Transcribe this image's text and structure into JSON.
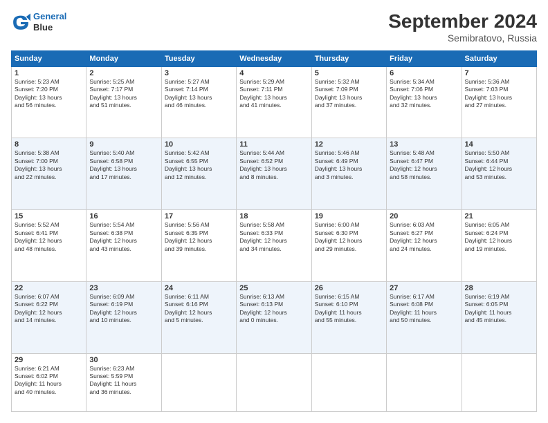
{
  "header": {
    "logo_line1": "General",
    "logo_line2": "Blue",
    "title": "September 2024",
    "subtitle": "Semibratovo, Russia"
  },
  "days_of_week": [
    "Sunday",
    "Monday",
    "Tuesday",
    "Wednesday",
    "Thursday",
    "Friday",
    "Saturday"
  ],
  "weeks": [
    [
      {
        "day": 1,
        "info": "Sunrise: 5:23 AM\nSunset: 7:20 PM\nDaylight: 13 hours\nand 56 minutes."
      },
      {
        "day": 2,
        "info": "Sunrise: 5:25 AM\nSunset: 7:17 PM\nDaylight: 13 hours\nand 51 minutes."
      },
      {
        "day": 3,
        "info": "Sunrise: 5:27 AM\nSunset: 7:14 PM\nDaylight: 13 hours\nand 46 minutes."
      },
      {
        "day": 4,
        "info": "Sunrise: 5:29 AM\nSunset: 7:11 PM\nDaylight: 13 hours\nand 41 minutes."
      },
      {
        "day": 5,
        "info": "Sunrise: 5:32 AM\nSunset: 7:09 PM\nDaylight: 13 hours\nand 37 minutes."
      },
      {
        "day": 6,
        "info": "Sunrise: 5:34 AM\nSunset: 7:06 PM\nDaylight: 13 hours\nand 32 minutes."
      },
      {
        "day": 7,
        "info": "Sunrise: 5:36 AM\nSunset: 7:03 PM\nDaylight: 13 hours\nand 27 minutes."
      }
    ],
    [
      {
        "day": 8,
        "info": "Sunrise: 5:38 AM\nSunset: 7:00 PM\nDaylight: 13 hours\nand 22 minutes."
      },
      {
        "day": 9,
        "info": "Sunrise: 5:40 AM\nSunset: 6:58 PM\nDaylight: 13 hours\nand 17 minutes."
      },
      {
        "day": 10,
        "info": "Sunrise: 5:42 AM\nSunset: 6:55 PM\nDaylight: 13 hours\nand 12 minutes."
      },
      {
        "day": 11,
        "info": "Sunrise: 5:44 AM\nSunset: 6:52 PM\nDaylight: 13 hours\nand 8 minutes."
      },
      {
        "day": 12,
        "info": "Sunrise: 5:46 AM\nSunset: 6:49 PM\nDaylight: 13 hours\nand 3 minutes."
      },
      {
        "day": 13,
        "info": "Sunrise: 5:48 AM\nSunset: 6:47 PM\nDaylight: 12 hours\nand 58 minutes."
      },
      {
        "day": 14,
        "info": "Sunrise: 5:50 AM\nSunset: 6:44 PM\nDaylight: 12 hours\nand 53 minutes."
      }
    ],
    [
      {
        "day": 15,
        "info": "Sunrise: 5:52 AM\nSunset: 6:41 PM\nDaylight: 12 hours\nand 48 minutes."
      },
      {
        "day": 16,
        "info": "Sunrise: 5:54 AM\nSunset: 6:38 PM\nDaylight: 12 hours\nand 43 minutes."
      },
      {
        "day": 17,
        "info": "Sunrise: 5:56 AM\nSunset: 6:35 PM\nDaylight: 12 hours\nand 39 minutes."
      },
      {
        "day": 18,
        "info": "Sunrise: 5:58 AM\nSunset: 6:33 PM\nDaylight: 12 hours\nand 34 minutes."
      },
      {
        "day": 19,
        "info": "Sunrise: 6:00 AM\nSunset: 6:30 PM\nDaylight: 12 hours\nand 29 minutes."
      },
      {
        "day": 20,
        "info": "Sunrise: 6:03 AM\nSunset: 6:27 PM\nDaylight: 12 hours\nand 24 minutes."
      },
      {
        "day": 21,
        "info": "Sunrise: 6:05 AM\nSunset: 6:24 PM\nDaylight: 12 hours\nand 19 minutes."
      }
    ],
    [
      {
        "day": 22,
        "info": "Sunrise: 6:07 AM\nSunset: 6:22 PM\nDaylight: 12 hours\nand 14 minutes."
      },
      {
        "day": 23,
        "info": "Sunrise: 6:09 AM\nSunset: 6:19 PM\nDaylight: 12 hours\nand 10 minutes."
      },
      {
        "day": 24,
        "info": "Sunrise: 6:11 AM\nSunset: 6:16 PM\nDaylight: 12 hours\nand 5 minutes."
      },
      {
        "day": 25,
        "info": "Sunrise: 6:13 AM\nSunset: 6:13 PM\nDaylight: 12 hours\nand 0 minutes."
      },
      {
        "day": 26,
        "info": "Sunrise: 6:15 AM\nSunset: 6:10 PM\nDaylight: 11 hours\nand 55 minutes."
      },
      {
        "day": 27,
        "info": "Sunrise: 6:17 AM\nSunset: 6:08 PM\nDaylight: 11 hours\nand 50 minutes."
      },
      {
        "day": 28,
        "info": "Sunrise: 6:19 AM\nSunset: 6:05 PM\nDaylight: 11 hours\nand 45 minutes."
      }
    ],
    [
      {
        "day": 29,
        "info": "Sunrise: 6:21 AM\nSunset: 6:02 PM\nDaylight: 11 hours\nand 40 minutes."
      },
      {
        "day": 30,
        "info": "Sunrise: 6:23 AM\nSunset: 5:59 PM\nDaylight: 11 hours\nand 36 minutes."
      },
      null,
      null,
      null,
      null,
      null
    ]
  ]
}
